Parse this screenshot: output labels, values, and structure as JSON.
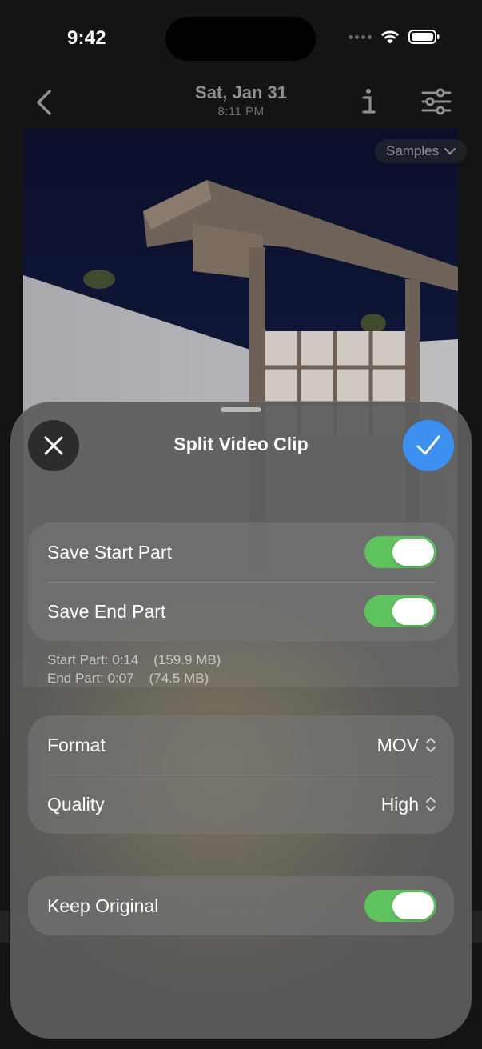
{
  "status_bar": {
    "time": "9:42"
  },
  "nav": {
    "title": "Sat, Jan 31",
    "subtitle": "8:11 PM"
  },
  "photo": {
    "album_chip": "Samples"
  },
  "sheet": {
    "title": "Split Video Clip",
    "parts_group": [
      {
        "label": "Save Start Part",
        "on": true
      },
      {
        "label": "Save End Part",
        "on": true
      }
    ],
    "info": {
      "start": "Start Part: 0:14    (159.9 MB)",
      "end": "End Part: 0:07    (74.5 MB)"
    },
    "options_group": [
      {
        "label": "Format",
        "value": "MOV"
      },
      {
        "label": "Quality",
        "value": "High"
      }
    ],
    "keep_original": {
      "label": "Keep Original",
      "on": true
    }
  },
  "colors": {
    "accent_blue": "#3d8ff0",
    "toggle_green": "#5ec35f"
  }
}
